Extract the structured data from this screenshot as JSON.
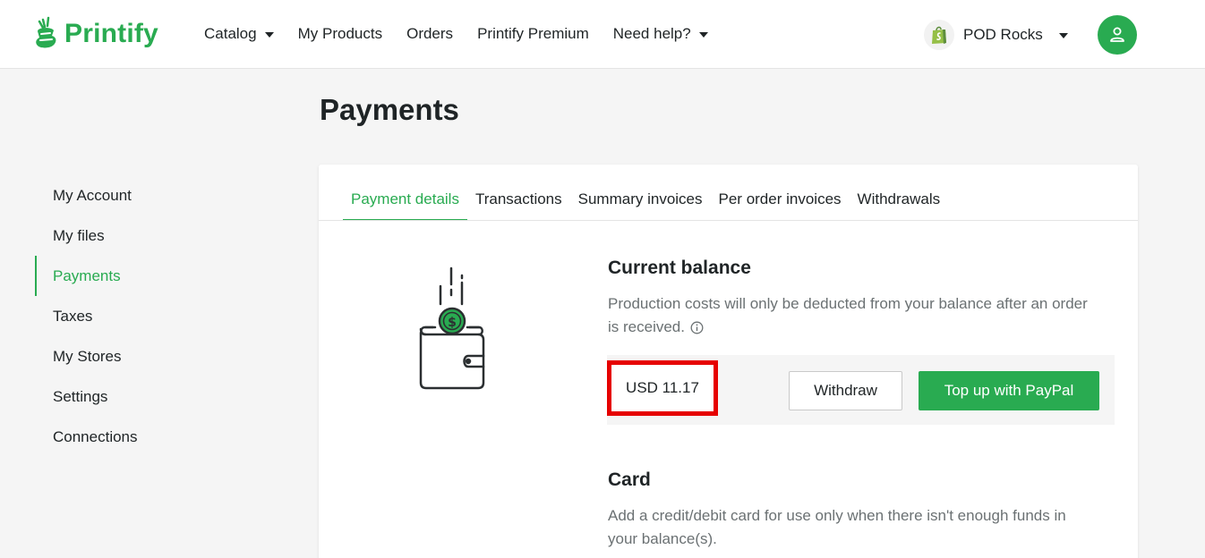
{
  "brand": {
    "name": "Printify",
    "accent": "#29ab51",
    "highlight_border": "#e60000"
  },
  "nav": {
    "items": [
      {
        "label": "Catalog",
        "dropdown": true
      },
      {
        "label": "My Products",
        "dropdown": false
      },
      {
        "label": "Orders",
        "dropdown": false
      },
      {
        "label": "Printify Premium",
        "dropdown": false
      },
      {
        "label": "Need help?",
        "dropdown": true
      }
    ]
  },
  "store": {
    "name": "POD Rocks",
    "icon": "shopify-bag-icon"
  },
  "user": {
    "icon": "user-icon"
  },
  "page": {
    "title": "Payments"
  },
  "sidebar": {
    "items": [
      {
        "label": "My Account"
      },
      {
        "label": "My files"
      },
      {
        "label": "Payments",
        "active": true
      },
      {
        "label": "Taxes"
      },
      {
        "label": "My Stores"
      },
      {
        "label": "Settings"
      },
      {
        "label": "Connections"
      }
    ]
  },
  "tabs": [
    {
      "label": "Payment details",
      "active": true
    },
    {
      "label": "Transactions"
    },
    {
      "label": "Summary invoices"
    },
    {
      "label": "Per order invoices"
    },
    {
      "label": "Withdrawals"
    }
  ],
  "balance": {
    "title": "Current balance",
    "description_line1": "Production costs will only be deducted from your balance after an order",
    "description_line2": "is received.",
    "amount": "USD 11.17",
    "withdraw_label": "Withdraw",
    "topup_label": "Top up with PayPal"
  },
  "card": {
    "title": "Card",
    "description_line1": "Add a credit/debit card for use only when there isn't enough funds in",
    "description_line2": "your balance(s)."
  }
}
